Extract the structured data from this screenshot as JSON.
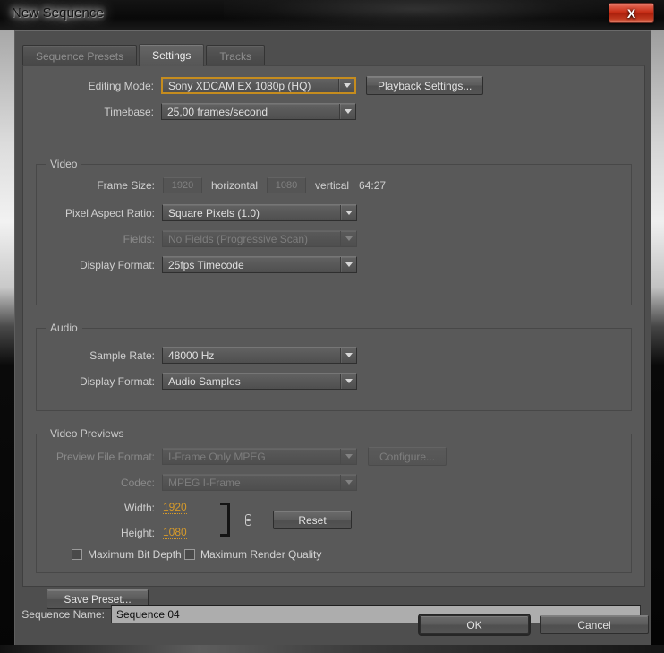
{
  "window": {
    "title": "New Sequence",
    "close_label": "X",
    "close_icon": "close-icon"
  },
  "tabs": [
    {
      "label": "Sequence Presets",
      "active": false
    },
    {
      "label": "Settings",
      "active": true
    },
    {
      "label": "Tracks",
      "active": false
    }
  ],
  "top": {
    "editing_mode_label": "Editing Mode:",
    "editing_mode_value": "Sony XDCAM EX 1080p (HQ)",
    "playback_settings_label": "Playback Settings...",
    "timebase_label": "Timebase:",
    "timebase_value": "25,00 frames/second"
  },
  "video": {
    "group_title": "Video",
    "frame_size_label": "Frame Size:",
    "frame_width": "1920",
    "horizontal_label": "horizontal",
    "frame_height": "1080",
    "vertical_label": "vertical",
    "aspect_ratio": "64:27",
    "pixel_aspect_label": "Pixel Aspect Ratio:",
    "pixel_aspect_value": "Square Pixels (1.0)",
    "fields_label": "Fields:",
    "fields_value": "No Fields (Progressive Scan)",
    "display_format_label": "Display Format:",
    "display_format_value": "25fps Timecode"
  },
  "audio": {
    "group_title": "Audio",
    "sample_rate_label": "Sample Rate:",
    "sample_rate_value": "48000 Hz",
    "display_format_label": "Display Format:",
    "display_format_value": "Audio Samples"
  },
  "previews": {
    "group_title": "Video Previews",
    "preview_format_label": "Preview File Format:",
    "preview_format_value": "I-Frame Only MPEG",
    "configure_label": "Configure...",
    "codec_label": "Codec:",
    "codec_value": "MPEG I-Frame",
    "width_label": "Width:",
    "width_value": "1920",
    "height_label": "Height:",
    "height_value": "1080",
    "reset_label": "Reset",
    "link_icon": "chain-link-icon",
    "max_bit_depth_label": "Maximum Bit Depth",
    "max_bit_depth_checked": false,
    "max_render_quality_label": "Maximum Render Quality",
    "max_render_quality_checked": false
  },
  "footer": {
    "save_preset_label": "Save Preset...",
    "sequence_name_label": "Sequence Name:",
    "sequence_name_value": "Sequence 04",
    "ok_label": "OK",
    "cancel_label": "Cancel"
  },
  "colors": {
    "accent_focus": "#c58c1e",
    "scrub_value": "#d69a2a",
    "panel_bg": "#595959",
    "dialog_bg": "#4e4e4e",
    "close_red": "#c62d16"
  }
}
